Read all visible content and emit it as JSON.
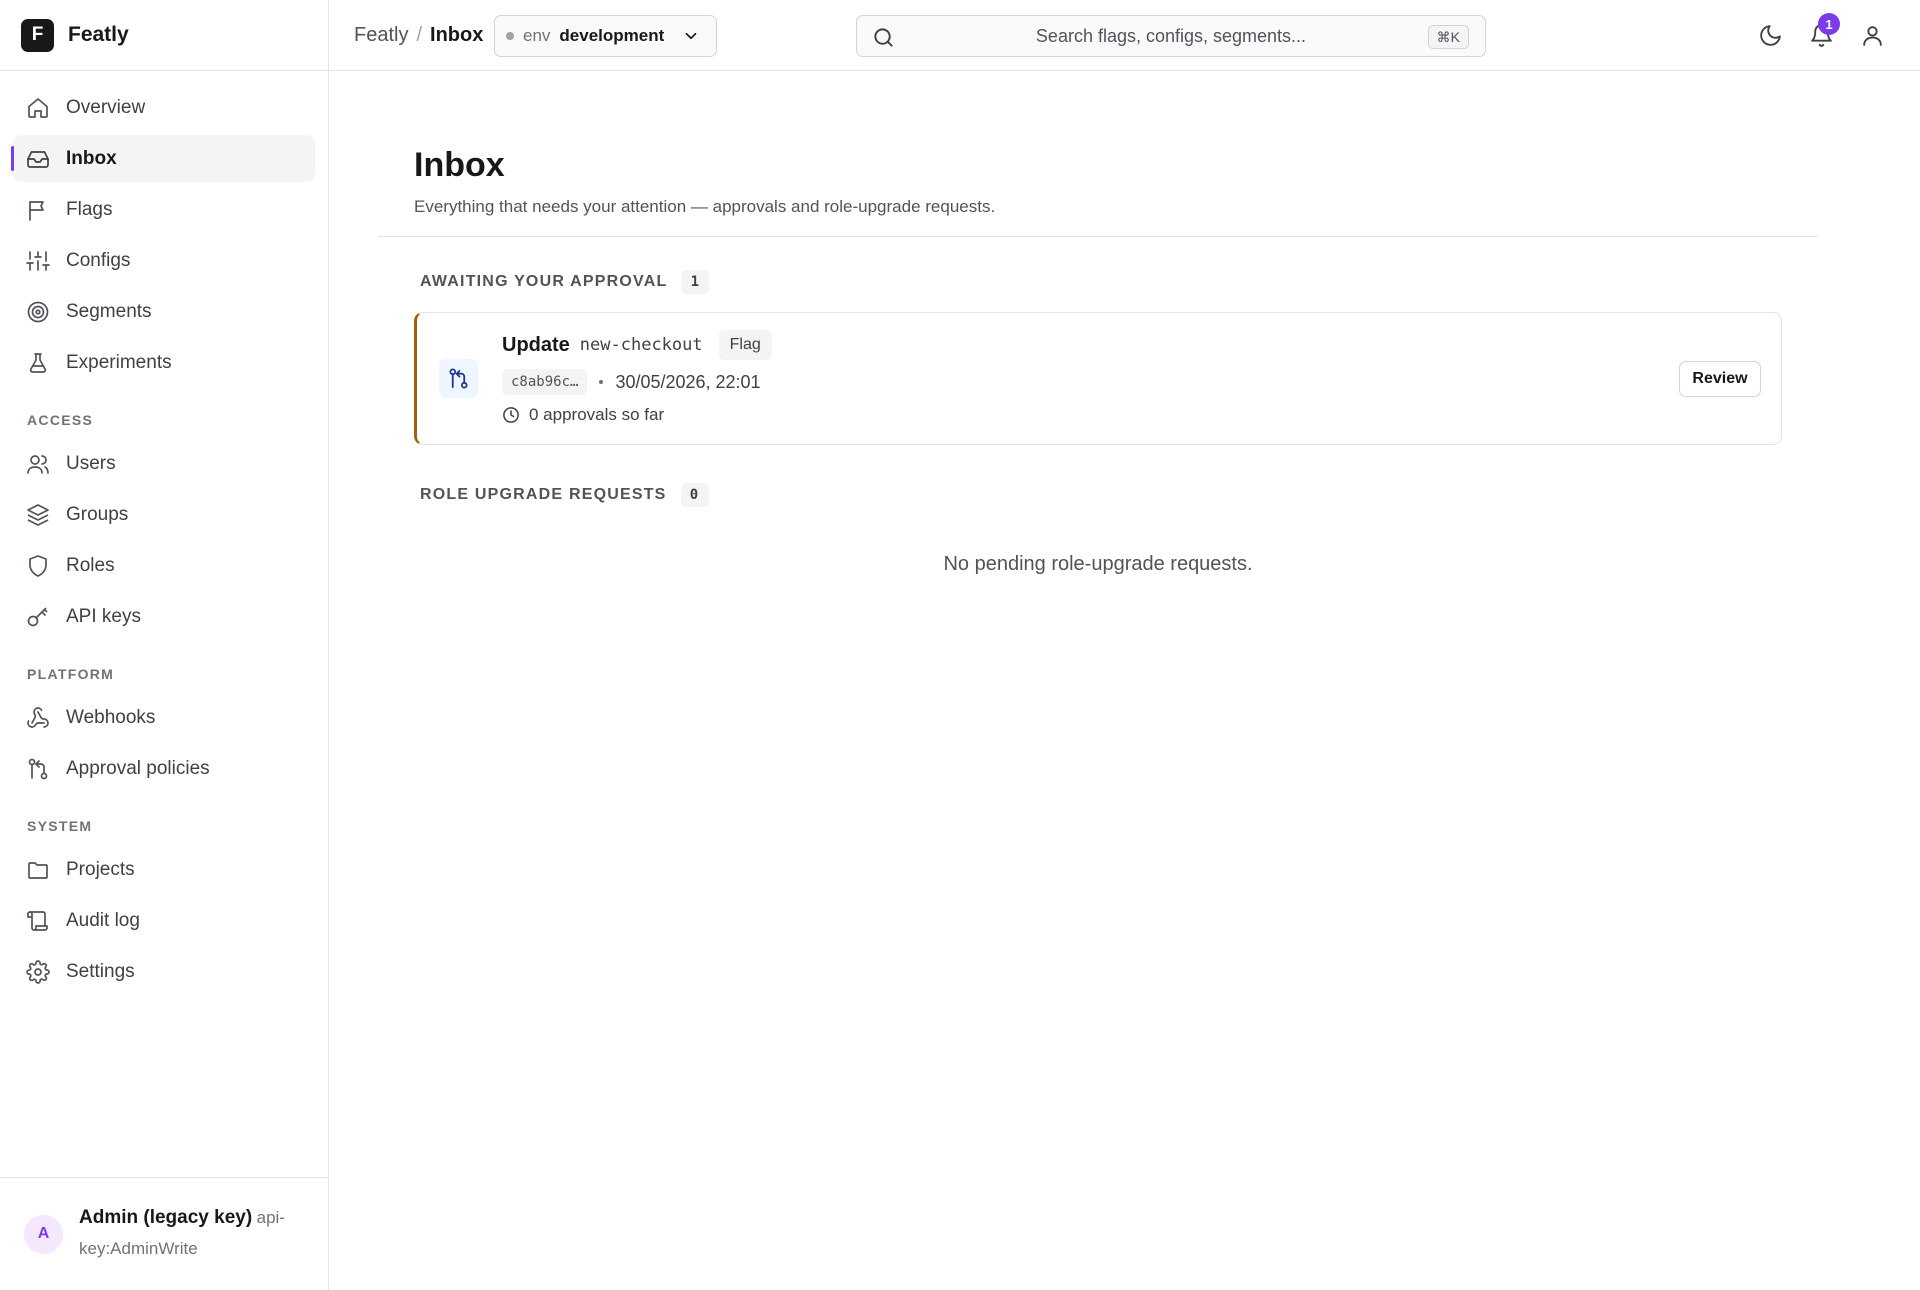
{
  "brand": {
    "logo_letter": "F",
    "name": "Featly"
  },
  "nav": {
    "main": [
      {
        "label": "Overview",
        "icon": "home-icon"
      },
      {
        "label": "Inbox",
        "icon": "inbox-icon",
        "active": true
      },
      {
        "label": "Flags",
        "icon": "flag-icon"
      },
      {
        "label": "Configs",
        "icon": "sliders-icon"
      },
      {
        "label": "Segments",
        "icon": "target-icon"
      },
      {
        "label": "Experiments",
        "icon": "flask-icon"
      }
    ],
    "access_label": "ACCESS",
    "access": [
      {
        "label": "Users",
        "icon": "users-icon"
      },
      {
        "label": "Groups",
        "icon": "layers-icon"
      },
      {
        "label": "Roles",
        "icon": "shield-icon"
      },
      {
        "label": "API keys",
        "icon": "key-icon"
      }
    ],
    "platform_label": "PLATFORM",
    "platform": [
      {
        "label": "Webhooks",
        "icon": "webhook-icon"
      },
      {
        "label": "Approval policies",
        "icon": "git-pull-request-icon"
      }
    ],
    "system_label": "SYSTEM",
    "system": [
      {
        "label": "Projects",
        "icon": "folder-icon"
      },
      {
        "label": "Audit log",
        "icon": "scroll-icon"
      },
      {
        "label": "Settings",
        "icon": "gear-icon"
      }
    ]
  },
  "user": {
    "avatar_letter": "A",
    "name": "Admin (legacy key)",
    "subtitle": "api-key:AdminWrite"
  },
  "topbar": {
    "breadcrumb_root": "Featly",
    "breadcrumb_sep": "/",
    "breadcrumb_current": "Inbox",
    "env_label": "env",
    "env_value": "development",
    "search_placeholder": "Search flags, configs, segments...",
    "search_shortcut": "⌘K",
    "notification_count": "1"
  },
  "page": {
    "title": "Inbox",
    "description": "Everything that needs your attention — approvals and role-upgrade requests."
  },
  "approvals": {
    "heading": "AWAITING YOUR APPROVAL",
    "count": "1",
    "items": [
      {
        "action": "Update",
        "key": "new-checkout",
        "type": "Flag",
        "hash": "c8ab96c…",
        "date": "30/05/2026, 22:01",
        "status": "0 approvals so far",
        "button": "Review"
      }
    ]
  },
  "role_requests": {
    "heading": "ROLE UPGRADE REQUESTS",
    "count": "0",
    "empty": "No pending role-upgrade requests."
  },
  "colors": {
    "accent": "#7c3aed",
    "card_border_accent": "#a16207"
  }
}
